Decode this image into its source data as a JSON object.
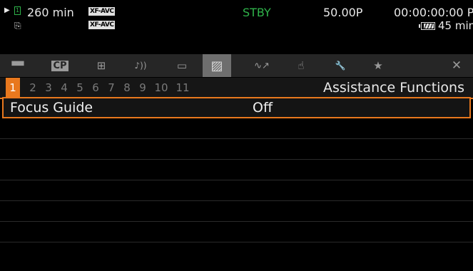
{
  "status": {
    "play_glyph": "▶",
    "card_slot": "1",
    "remaining_time": "260 min",
    "format_top": "XF-AVC",
    "format_bottom": "XF-AVC",
    "mode": "STBY",
    "frame_rate": "50.00P",
    "timecode": "00:00:00:00 P",
    "battery_time": "45 min",
    "icons": [
      "play-indicator-icon",
      "card-slot-icon",
      "card-relay-icon",
      "battery-icon"
    ]
  },
  "tabs": [
    {
      "name": "camera-setup-tab",
      "glyph": "▀▀",
      "icon": "camera-icon"
    },
    {
      "name": "custom-picture-tab",
      "glyph": "CP",
      "icon": "cp-icon"
    },
    {
      "name": "recording-setup-tab",
      "glyph": "⊞",
      "icon": "recording-setup-icon"
    },
    {
      "name": "audio-setup-tab",
      "glyph": "♪))",
      "icon": "audio-icon"
    },
    {
      "name": "video-setup-tab",
      "glyph": "▭",
      "icon": "video-icon"
    },
    {
      "name": "assistance-functions-tab",
      "glyph": "▨",
      "icon": "assistance-icon",
      "active": true
    },
    {
      "name": "network-tab",
      "glyph": "∿↗",
      "icon": "network-icon"
    },
    {
      "name": "custom-functions-tab",
      "glyph": "☝",
      "icon": "custom-function-icon"
    },
    {
      "name": "system-setup-tab",
      "glyph": "🔧",
      "icon": "wrench-icon"
    },
    {
      "name": "my-menu-tab",
      "glyph": "★",
      "icon": "star-icon"
    }
  ],
  "close_glyph": "✕",
  "pages": [
    "1",
    "2",
    "3",
    "4",
    "5",
    "6",
    "7",
    "8",
    "9",
    "10",
    "11"
  ],
  "active_page": "1",
  "menu_title": "Assistance Functions",
  "rows": [
    {
      "label": "Focus Guide",
      "value": "Off",
      "selected": true
    },
    {
      "label": "",
      "value": ""
    },
    {
      "label": "",
      "value": ""
    },
    {
      "label": "",
      "value": ""
    },
    {
      "label": "",
      "value": ""
    },
    {
      "label": "",
      "value": ""
    },
    {
      "label": "",
      "value": ""
    },
    {
      "label": "",
      "value": ""
    }
  ],
  "colors": {
    "accent": "#e8781e",
    "standby": "#2fb34a",
    "tab_bar": "#262626",
    "active_tab": "#6e6e6e"
  }
}
